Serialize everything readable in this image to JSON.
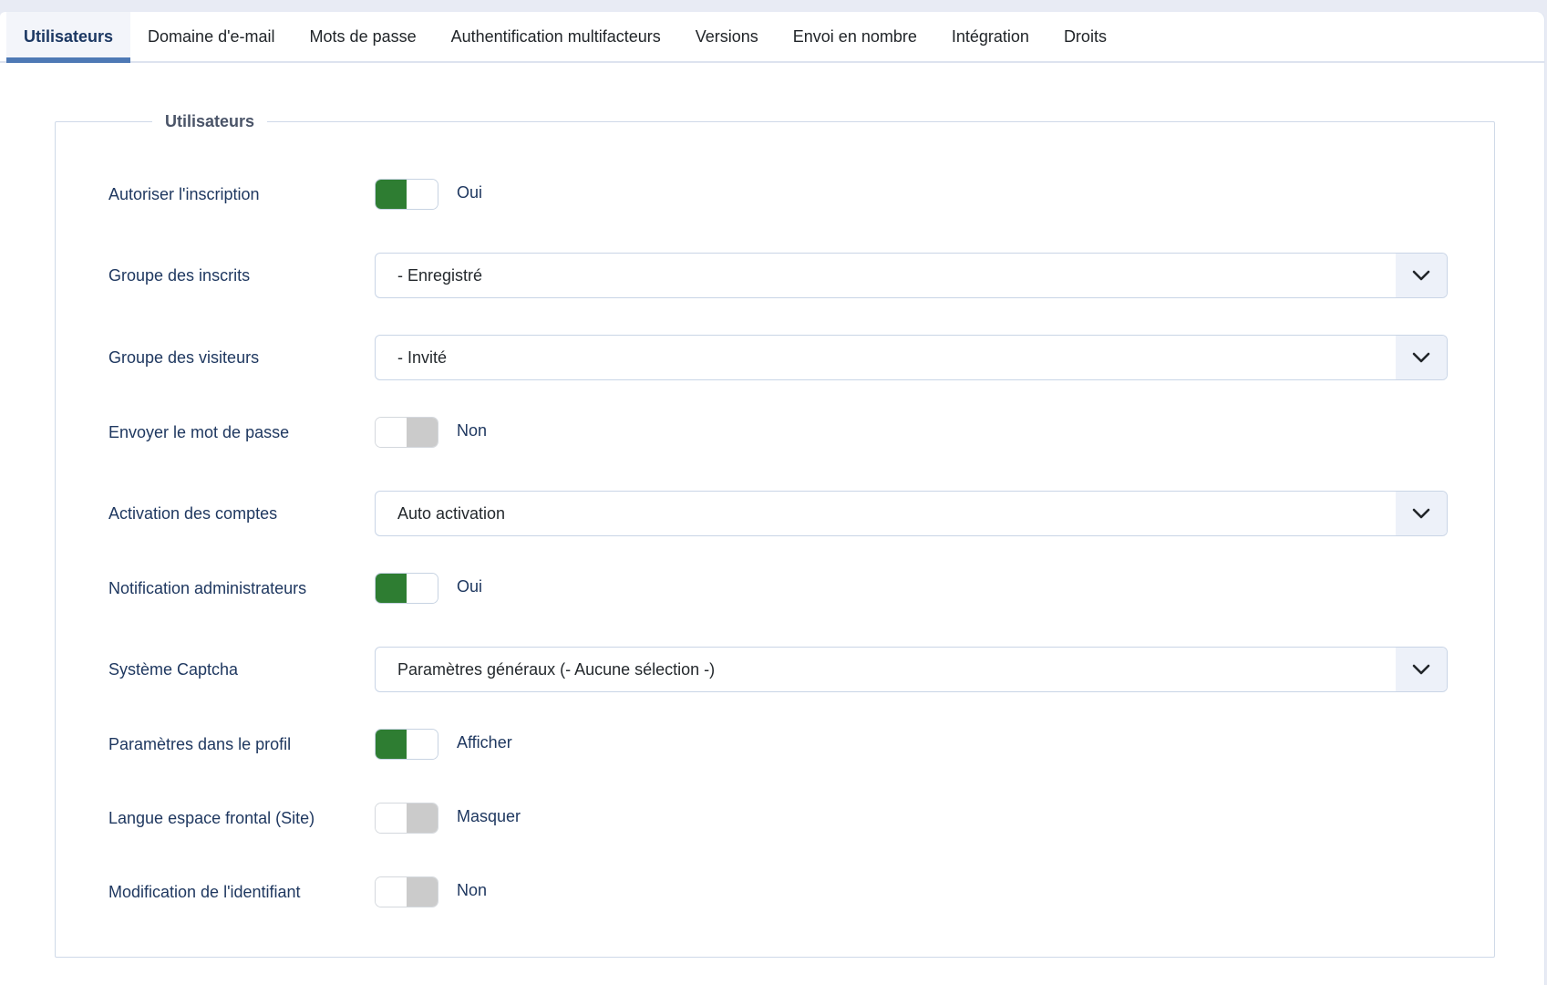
{
  "tabs": {
    "items": [
      {
        "label": "Utilisateurs",
        "state": "active"
      },
      {
        "label": "Domaine d'e-mail"
      },
      {
        "label": "Mots de passe"
      },
      {
        "label": "Authentification multifacteurs"
      },
      {
        "label": "Versions"
      },
      {
        "label": "Envoi en nombre"
      },
      {
        "label": "Intégration"
      },
      {
        "label": "Droits"
      }
    ]
  },
  "panel": {
    "legend": "Utilisateurs"
  },
  "fields": [
    {
      "label": "Autoriser l'inscription",
      "type": "toggle",
      "state": "on",
      "value": "Oui"
    },
    {
      "label": "Groupe des inscrits",
      "type": "select",
      "value": "- Enregistré"
    },
    {
      "label": "Groupe des visiteurs",
      "type": "select",
      "value": "- Invité"
    },
    {
      "label": "Envoyer le mot de passe",
      "type": "toggle",
      "state": "off",
      "value": "Non"
    },
    {
      "label": "Activation des comptes",
      "type": "select",
      "value": "Auto activation"
    },
    {
      "label": "Notification administrateurs",
      "type": "toggle",
      "state": "on",
      "value": "Oui"
    },
    {
      "label": "Système Captcha",
      "type": "select",
      "value": "Paramètres généraux (- Aucune sélection -)"
    },
    {
      "label": "Paramètres dans le profil",
      "type": "toggle",
      "state": "on",
      "value": "Afficher"
    },
    {
      "label": "Langue espace frontal (Site)",
      "type": "toggle",
      "state": "off",
      "value": "Masquer"
    },
    {
      "label": "Modification de l'identifiant",
      "type": "toggle",
      "state": "off",
      "value": "Non"
    }
  ],
  "colors": {
    "toggle_on": "#2e7d32",
    "toggle_off": "#cbcbcb",
    "tab_underline": "#4e79b5",
    "label_navy": "#1f3860",
    "page_background": "#e8ebf4"
  },
  "icons": {
    "select_addon": "chevron-down-icon"
  }
}
